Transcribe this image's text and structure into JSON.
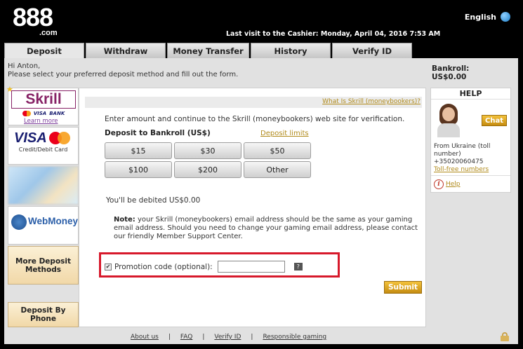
{
  "header": {
    "logo_text": "888",
    "logo_domain": ".com",
    "language": "English",
    "last_visit": "Last visit to the Cashier: Monday, April 04, 2016 7:53 AM"
  },
  "tabs": [
    {
      "label": "Deposit",
      "active": true
    },
    {
      "label": "Withdraw",
      "active": false
    },
    {
      "label": "Money Transfer",
      "active": false
    },
    {
      "label": "History",
      "active": false
    },
    {
      "label": "Verify ID",
      "active": false
    }
  ],
  "greeting": {
    "line1": "Hi Anton,",
    "line2": "Please select your preferred deposit method and fill out the form."
  },
  "bankroll": {
    "label": "Bankroll:",
    "value": "US$0.00"
  },
  "methods": {
    "skrill": {
      "logo": "Skrill",
      "sub_visa": "VISA",
      "sub_bank": "BANK",
      "learn_more": "Learn more"
    },
    "visa": {
      "logo": "VISA",
      "sub": "Credit/Debit Card"
    },
    "webmoney": {
      "logo": "WebMoney"
    },
    "more_label": "More Deposit Methods",
    "phone_label": "Deposit By Phone"
  },
  "form": {
    "what_is_link": "What Is Skrill (moneybookers)?",
    "intro": "Enter amount and continue to the Skrill (moneybookers) web site for verification.",
    "deposit_label": "Deposit to Bankroll (US$)",
    "limits_link": "Deposit limits",
    "amounts": [
      "$15",
      "$30",
      "$50",
      "$100",
      "$200",
      "Other"
    ],
    "debited": "You'll be debited US$0.00",
    "note_label": "Note:",
    "note_text": "your Skrill (moneybookers) email address should be the same as your gaming email address. Should you need to change your gaming email address, please contact our friendly Member Support Center.",
    "promo_checked": true,
    "promo_label": "Promotion code (optional):",
    "promo_value": "",
    "submit_label": "Submit"
  },
  "help": {
    "title": "HELP",
    "chat_label": "Chat",
    "contact_line1": "From Ukraine (toll number)",
    "contact_phone": "+35020060475",
    "tollfree_link": "Toll-free numbers",
    "help_link": "Help"
  },
  "footer": {
    "links": [
      "About us",
      "FAQ",
      "Verify ID",
      "Responsible gaming"
    ],
    "separator": "|"
  },
  "colors": {
    "accent_gold": "#c58c11",
    "highlight_red": "#d7192b",
    "skrill_purple": "#862165"
  }
}
